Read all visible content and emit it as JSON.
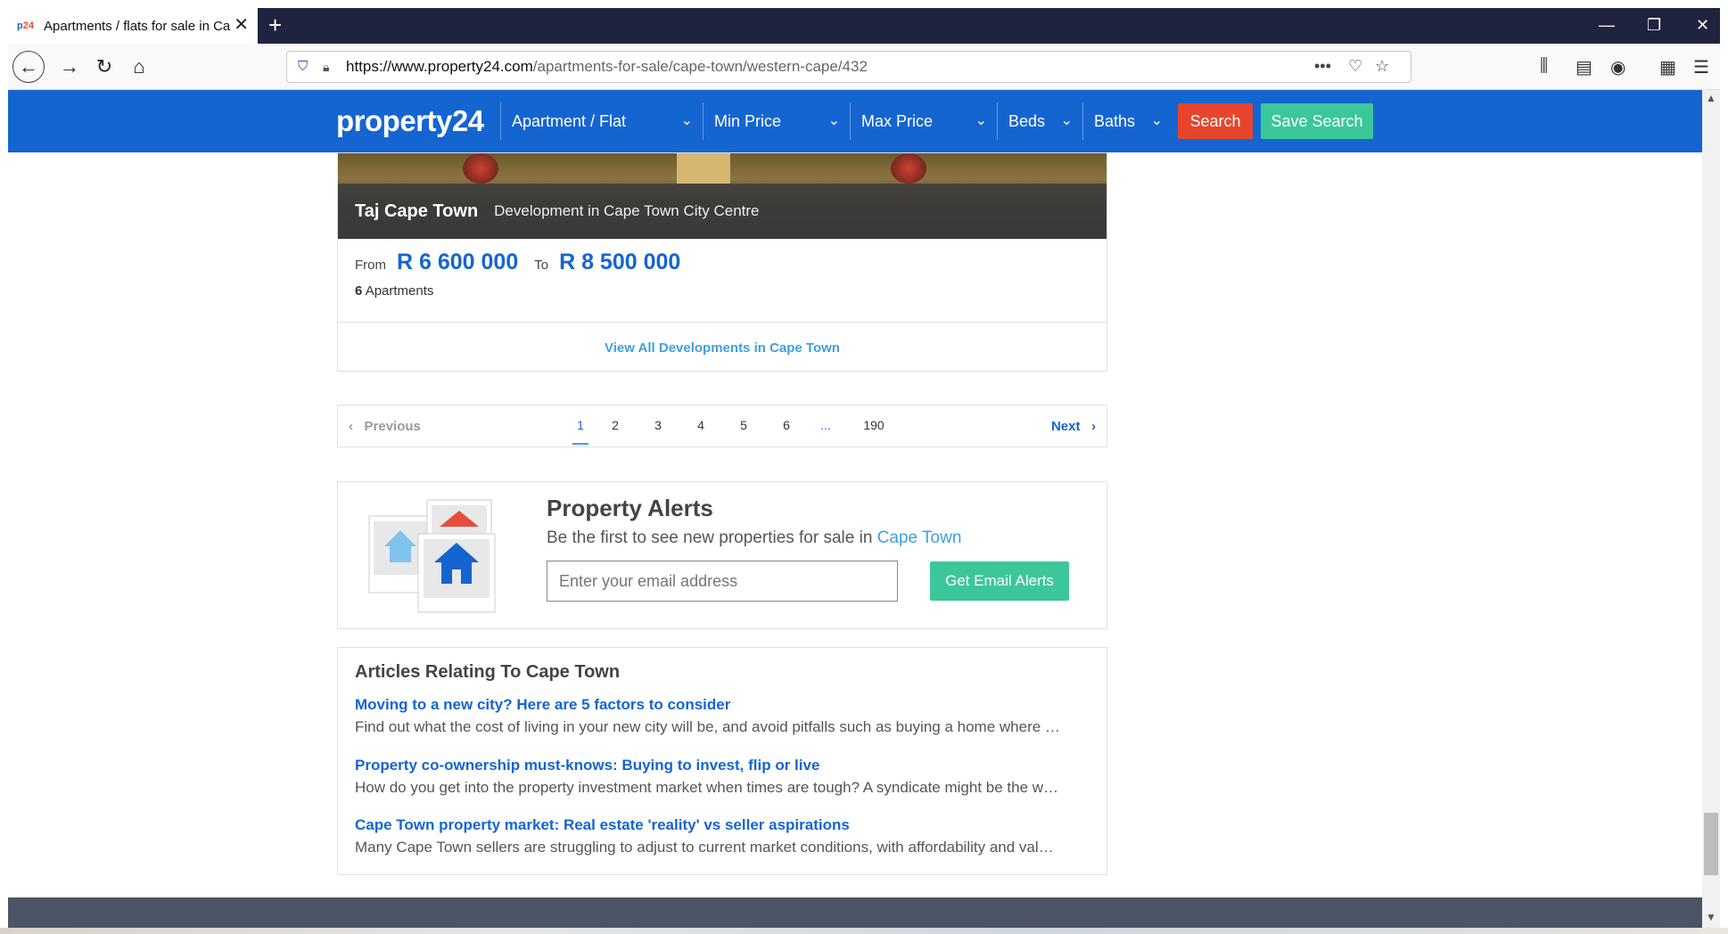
{
  "browser": {
    "tab_title": "Apartments / flats for sale in Ca",
    "favicon_text_1": "p",
    "favicon_text_2": "24",
    "url_domain": "https://www.property24.com",
    "url_path": "/apartments-for-sale/cape-town/western-cape/432",
    "url_dots": "•••"
  },
  "header": {
    "logo": "property24",
    "filters": [
      {
        "label": "Apartment / Flat"
      },
      {
        "label": "Min Price"
      },
      {
        "label": "Max Price"
      },
      {
        "label": "Beds"
      },
      {
        "label": "Baths"
      }
    ],
    "search_label": "Search",
    "save_search_label": "Save Search",
    "accent_color": "#1565d1",
    "search_color": "#e8452e",
    "save_color": "#3cc79a"
  },
  "development": {
    "name": "Taj Cape Town",
    "type": "Development in Cape Town City Centre",
    "from_label": "From",
    "from_price": "R 6 600 000",
    "to_label": "To",
    "to_price": "R 8 500 000",
    "count": "6",
    "count_label": "Apartments",
    "view_all": "View All Developments in Cape Town"
  },
  "pagination": {
    "previous": "Previous",
    "pages": [
      "1",
      "2",
      "3",
      "4",
      "5",
      "6",
      "...",
      "190"
    ],
    "active_page": "1",
    "next": "Next"
  },
  "alerts": {
    "title": "Property Alerts",
    "subtitle": "Be the first to see new properties for sale in",
    "location": "Cape Town",
    "email_placeholder": "Enter your email address",
    "button_label": "Get Email Alerts"
  },
  "articles": {
    "heading": "Articles Relating To Cape Town",
    "items": [
      {
        "title": "Moving to a new city? Here are 5 factors to consider",
        "desc": "Find out what the cost of living in your new city will be, and avoid pitfalls such as buying a home where …"
      },
      {
        "title": "Property co-ownership must-knows: Buying to invest, flip or live",
        "desc": "How do you get into the property investment market when times are tough? A syndicate might be the w…"
      },
      {
        "title": "Cape Town property market: Real estate 'reality' vs seller aspirations",
        "desc": "Many Cape Town sellers are struggling to adjust to current market conditions, with affordability and val…"
      }
    ]
  }
}
